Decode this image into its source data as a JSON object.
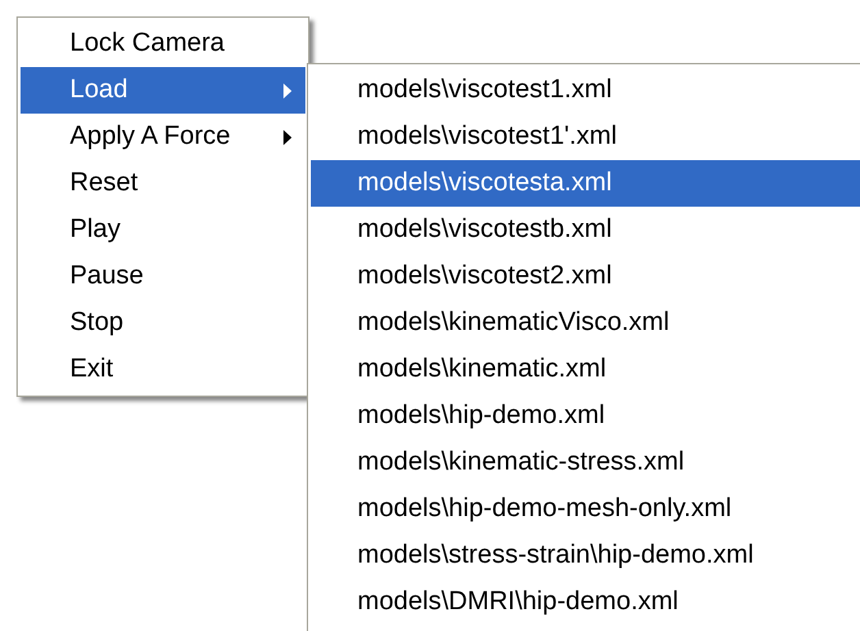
{
  "context_menu": {
    "items": [
      {
        "label": "Lock Camera",
        "selected": false,
        "submenu": false
      },
      {
        "label": "Load",
        "selected": true,
        "submenu": true
      },
      {
        "label": "Apply A Force",
        "selected": false,
        "submenu": true
      },
      {
        "label": "Reset",
        "selected": false,
        "submenu": false
      },
      {
        "label": "Play",
        "selected": false,
        "submenu": false
      },
      {
        "label": "Pause",
        "selected": false,
        "submenu": false
      },
      {
        "label": "Stop",
        "selected": false,
        "submenu": false
      },
      {
        "label": "Exit",
        "selected": false,
        "submenu": false
      }
    ]
  },
  "submenu": {
    "items": [
      {
        "label": "models\\viscotest1.xml",
        "selected": false
      },
      {
        "label": "models\\viscotest1'.xml",
        "selected": false
      },
      {
        "label": "models\\viscotesta.xml",
        "selected": true
      },
      {
        "label": "models\\viscotestb.xml",
        "selected": false
      },
      {
        "label": "models\\viscotest2.xml",
        "selected": false
      },
      {
        "label": "models\\kinematicVisco.xml",
        "selected": false
      },
      {
        "label": "models\\kinematic.xml",
        "selected": false
      },
      {
        "label": "models\\hip-demo.xml",
        "selected": false
      },
      {
        "label": "models\\kinematic-stress.xml",
        "selected": false
      },
      {
        "label": "models\\hip-demo-mesh-only.xml",
        "selected": false
      },
      {
        "label": "models\\stress-strain\\hip-demo.xml",
        "selected": false
      },
      {
        "label": "models\\DMRI\\hip-demo.xml",
        "selected": false
      }
    ]
  }
}
